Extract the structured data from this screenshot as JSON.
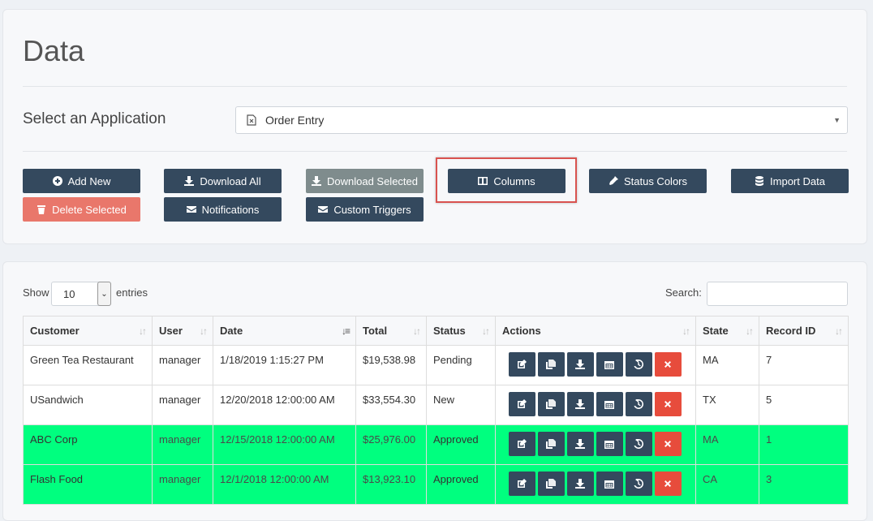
{
  "page": {
    "title": "Data"
  },
  "app_selector": {
    "label": "Select an Application",
    "value": "Order Entry"
  },
  "toolbar": {
    "add_new": "Add New",
    "download_all": "Download All",
    "download_selected": "Download Selected",
    "columns": "Columns",
    "status_colors": "Status Colors",
    "import_data": "Import Data",
    "delete_selected": "Delete Selected",
    "notifications": "Notifications",
    "custom_triggers": "Custom Triggers"
  },
  "table_controls": {
    "show_label": "Show",
    "entries_value": "10",
    "entries_label": "entries",
    "search_label": "Search:"
  },
  "table": {
    "headers": [
      "Customer",
      "User",
      "Date",
      "Total",
      "Status",
      "Actions",
      "State",
      "Record ID"
    ],
    "rows": [
      {
        "customer": "Green Tea Restaurant",
        "user": "manager",
        "date": "1/18/2019 1:15:27 PM",
        "total": "$19,538.98",
        "status": "Pending",
        "state": "MA",
        "record_id": "7"
      },
      {
        "customer": "USandwich",
        "user": "manager",
        "date": "12/20/2018 12:00:00 AM",
        "total": "$33,554.30",
        "status": "New",
        "state": "TX",
        "record_id": "5"
      },
      {
        "customer": "ABC Corp",
        "user": "manager",
        "date": "12/15/2018 12:00:00 AM",
        "total": "$25,976.00",
        "status": "Approved",
        "state": "MA",
        "record_id": "1"
      },
      {
        "customer": "Flash Food",
        "user": "manager",
        "date": "12/1/2018 12:00:00 AM",
        "total": "$13,923.10",
        "status": "Approved",
        "state": "CA",
        "record_id": "3"
      }
    ]
  },
  "colors": {
    "approved_row": "#00ff7f",
    "primary_button": "#34495e",
    "delete_button": "#e74c3c",
    "highlight": "#d9534f"
  }
}
